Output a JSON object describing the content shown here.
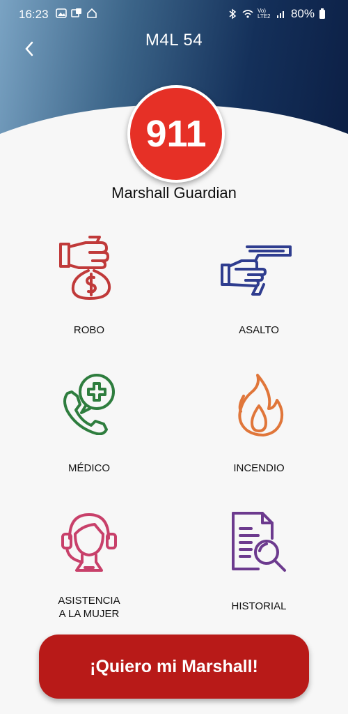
{
  "status_bar": {
    "time": "16:23",
    "battery": "80%",
    "network": "Vo) LTE2"
  },
  "header": {
    "title": "M4L 54",
    "back_icon": "chevron-left-icon"
  },
  "emergency": {
    "label": "911",
    "color": "#e63026"
  },
  "profile": {
    "name": "Marshall Guardian"
  },
  "tiles": [
    {
      "label": "ROBO",
      "icon": "robbery-money-bag-icon",
      "color": "#c03a3a"
    },
    {
      "label": "ASALTO",
      "icon": "assault-gun-hand-icon",
      "color": "#2f3d8f"
    },
    {
      "label": "MÉDICO",
      "icon": "medical-phone-cross-icon",
      "color": "#2e7d3e"
    },
    {
      "label": "INCENDIO",
      "icon": "fire-icon",
      "color": "#e0763a"
    },
    {
      "label_line1": "ASISTENCIA",
      "label_line2": "A LA MUJER",
      "icon": "woman-headset-icon",
      "color": "#c8406a"
    },
    {
      "label": "HISTORIAL",
      "icon": "document-search-icon",
      "color": "#6c3a8e"
    }
  ],
  "cta": {
    "label": "¡Quiero mi Marshall!",
    "color": "#b81a18"
  }
}
